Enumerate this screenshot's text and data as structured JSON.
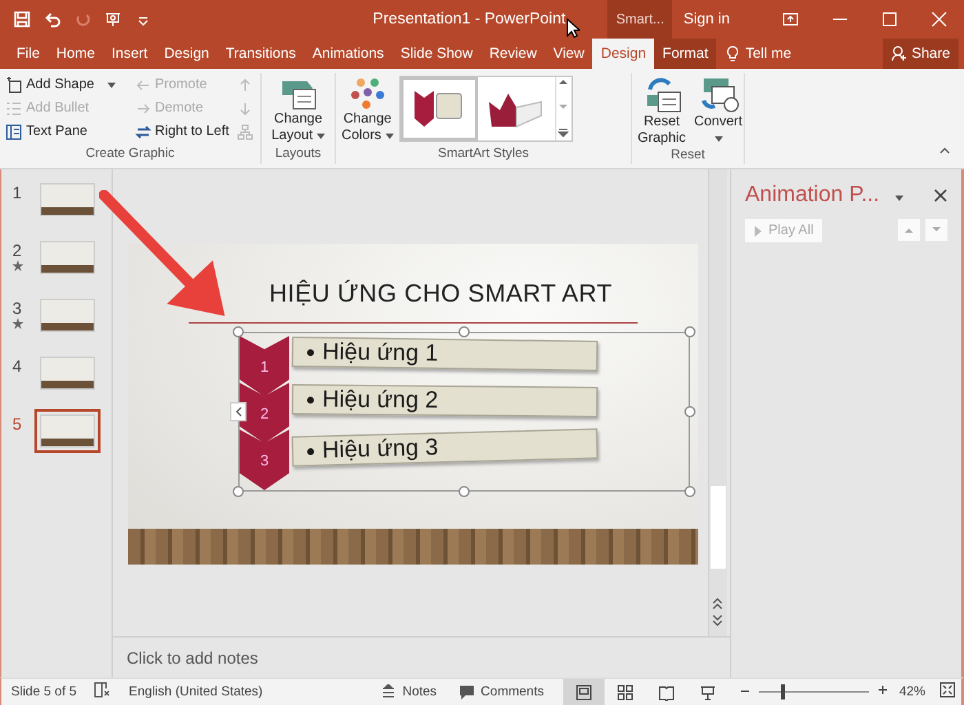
{
  "title_bar": {
    "title": "Presentation1  -  PowerPoint",
    "context_label": "Smart...",
    "sign_in": "Sign in"
  },
  "tabs": [
    {
      "label": "File",
      "kind": "normal",
      "selected": false
    },
    {
      "label": "Home",
      "kind": "normal",
      "selected": false
    },
    {
      "label": "Insert",
      "kind": "normal",
      "selected": false
    },
    {
      "label": "Design",
      "kind": "normal",
      "selected": false
    },
    {
      "label": "Transitions",
      "kind": "normal",
      "selected": false
    },
    {
      "label": "Animations",
      "kind": "normal",
      "selected": false
    },
    {
      "label": "Slide Show",
      "kind": "normal",
      "selected": false
    },
    {
      "label": "Review",
      "kind": "normal",
      "selected": false
    },
    {
      "label": "View",
      "kind": "normal",
      "selected": false
    },
    {
      "label": "Design",
      "kind": "contextual",
      "selected": true
    },
    {
      "label": "Format",
      "kind": "contextual",
      "selected": false
    }
  ],
  "tell_me": "Tell me",
  "share": "Share",
  "ribbon": {
    "create_graphic": {
      "label": "Create Graphic",
      "left": [
        {
          "label": "Add Shape",
          "disabled": false,
          "dropdown": true
        },
        {
          "label": "Add Bullet",
          "disabled": true,
          "dropdown": false
        },
        {
          "label": "Text Pane",
          "disabled": false,
          "dropdown": false
        }
      ],
      "right": [
        {
          "label": "Promote",
          "disabled": true
        },
        {
          "label": "Demote",
          "disabled": true
        },
        {
          "label": "Right to Left",
          "disabled": false
        }
      ]
    },
    "layouts": {
      "label": "Layouts",
      "button": [
        "Change",
        "Layout"
      ]
    },
    "styles": {
      "label": "SmartArt Styles",
      "colors_button": [
        "Change",
        "Colors"
      ],
      "gallery": [
        {
          "selected": true
        },
        {
          "selected": false
        }
      ]
    },
    "reset": {
      "label": "Reset",
      "buttons": [
        {
          "lines": [
            "Reset",
            "Graphic"
          ]
        },
        {
          "lines": [
            "Convert"
          ]
        }
      ]
    }
  },
  "thumbnails": [
    {
      "number": "1",
      "selected": false,
      "animated": false
    },
    {
      "number": "2",
      "selected": false,
      "animated": true
    },
    {
      "number": "3",
      "selected": false,
      "animated": true
    },
    {
      "number": "4",
      "selected": false,
      "animated": false
    },
    {
      "number": "5",
      "selected": true,
      "animated": false
    }
  ],
  "slide": {
    "title": "HIỆU ỨNG CHO SMART ART",
    "items": [
      {
        "number": "1",
        "text": "Hiệu ứng 1"
      },
      {
        "number": "2",
        "text": "Hiệu ứng 2"
      },
      {
        "number": "3",
        "text": "Hiệu ứng 3"
      }
    ]
  },
  "notes": {
    "placeholder": "Click to add notes"
  },
  "animation_pane": {
    "title": "Animation P...",
    "play_all": "Play All",
    "play_disabled": true
  },
  "status_bar": {
    "slide": "Slide 5 of 5",
    "language": "English (United States)",
    "notes": "Notes",
    "comments": "Comments",
    "views": [
      {
        "selected": true
      },
      {
        "selected": false
      },
      {
        "selected": false
      },
      {
        "selected": false
      }
    ],
    "zoom": {
      "level": 0.2
    },
    "zoom_text": "42%"
  }
}
